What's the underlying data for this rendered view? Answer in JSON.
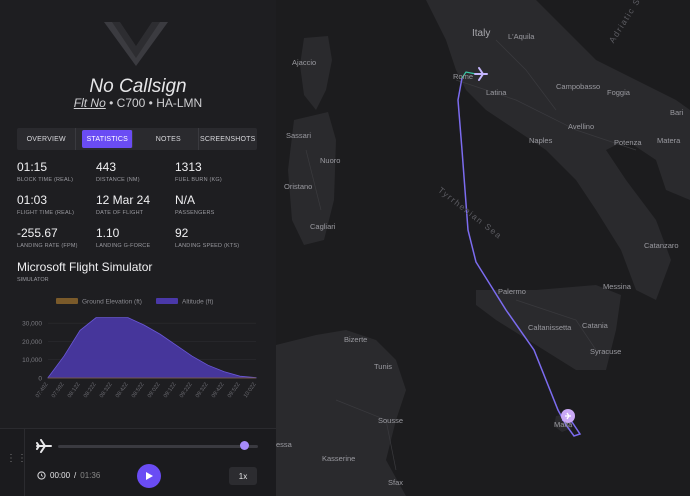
{
  "header": {
    "callsign": "No Callsign",
    "flt_no_label": "Flt No",
    "aircraft_line": "• C700 • HA-LMN"
  },
  "tabs": [
    {
      "label": "OVERVIEW"
    },
    {
      "label": "STATISTICS"
    },
    {
      "label": "NOTES"
    },
    {
      "label": "SCREENSHOTS"
    }
  ],
  "active_tab": "STATISTICS",
  "stats": [
    {
      "value": "01:15",
      "label": "BLOCK TIME (REAL)"
    },
    {
      "value": "443",
      "label": "DISTANCE (NM)"
    },
    {
      "value": "1313",
      "label": "FUEL BURN (KG)"
    },
    {
      "value": "01:03",
      "label": "FLIGHT TIME (REAL)"
    },
    {
      "value": "12 Mar 24",
      "label": "DATE OF FLIGHT"
    },
    {
      "value": "N/A",
      "label": "PASSENGERS"
    },
    {
      "value": "-255.67",
      "label": "LANDING RATE (FPM)"
    },
    {
      "value": "1.10",
      "label": "LANDING G-FORCE"
    },
    {
      "value": "92",
      "label": "LANDING SPEED (KTS)"
    }
  ],
  "simulator": {
    "value": "Microsoft Flight Simulator",
    "label": "SIMULATOR"
  },
  "chart_data": {
    "type": "area",
    "legend": [
      "Ground Elevation (ft)",
      "Altitude (ft)"
    ],
    "colors": {
      "ground": "#7a5a2a",
      "altitude": "#4a38a8"
    },
    "ylim": [
      0,
      35000
    ],
    "yticks": [
      "30,000",
      "20,000",
      "10,000",
      "0"
    ],
    "x": [
      "07:49",
      "07:59",
      "08:12",
      "08:22",
      "08:32",
      "08:42",
      "08:52",
      "09:02",
      "09:12",
      "09:22",
      "09:32",
      "09:42",
      "09:52",
      "10:02"
    ],
    "xticks": [
      "07:49Z",
      "07:59Z",
      "08:12Z",
      "08:22Z",
      "08:32Z",
      "08:42Z",
      "08:52Z",
      "09:02Z",
      "09:12Z",
      "09:22Z",
      "09:32Z",
      "09:42Z",
      "09:52Z",
      "10:02Z"
    ],
    "series": [
      {
        "name": "Altitude (ft)",
        "values": [
          200,
          12000,
          26000,
          33000,
          33000,
          33000,
          29000,
          24000,
          18000,
          12000,
          7000,
          3500,
          1000,
          200
        ]
      },
      {
        "name": "Ground Elevation (ft)",
        "values": [
          0,
          0,
          0,
          0,
          0,
          0,
          0,
          0,
          0,
          0,
          0,
          0,
          0,
          0
        ]
      }
    ]
  },
  "player": {
    "current": "00:00",
    "separator": "/",
    "total": "01:36",
    "speed": "1x",
    "progress": 0.93
  },
  "map": {
    "labels": {
      "country": "Italy",
      "sea1": "Tyrrhenian Sea",
      "sea2": "Adriatic Sea",
      "cities": [
        "L'Aquila",
        "Ajaccio",
        "Rome",
        "Latina",
        "Campobasso",
        "Foggia",
        "Bari",
        "Sassari",
        "Naples",
        "Avellino",
        "Potenza",
        "Matera",
        "Nuoro",
        "Oristano",
        "Cagliari",
        "Catanzaro",
        "Palermo",
        "Messina",
        "Caltanissetta",
        "Catania",
        "Syracuse",
        "Bizerte",
        "Tunis",
        "Sousse",
        "Malta",
        "Kasserine",
        "Sfax",
        "essa"
      ]
    },
    "route_color": "#7c6cf0"
  }
}
